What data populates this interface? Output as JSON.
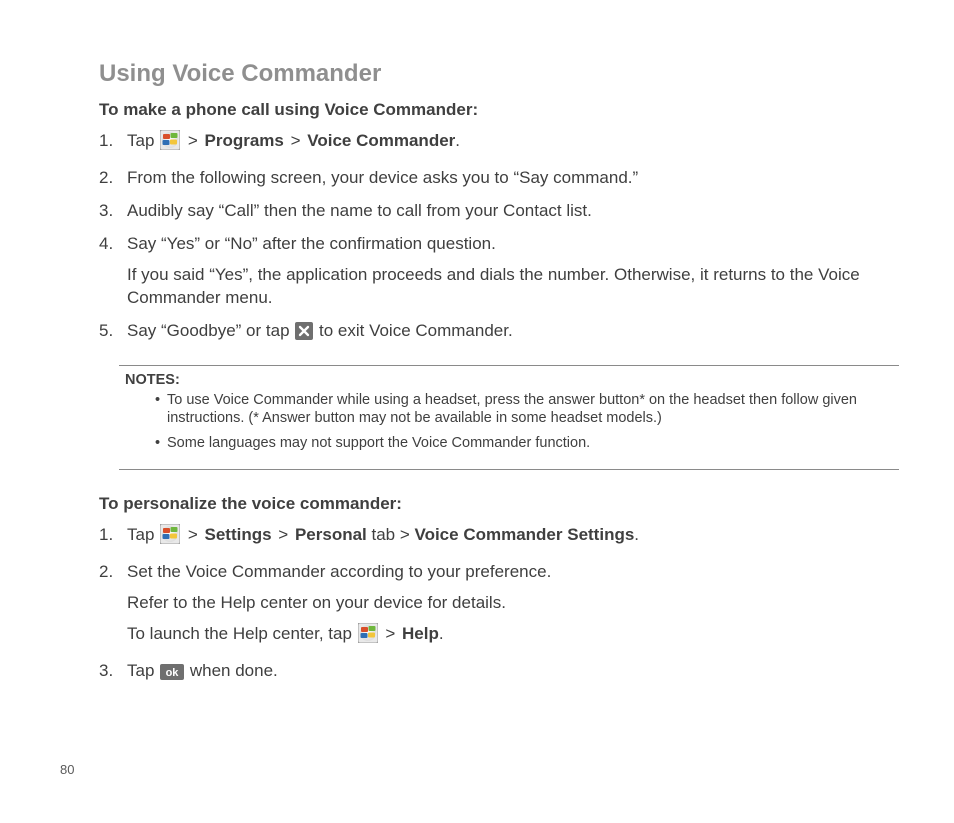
{
  "pageNumber": "80",
  "title": "Using Voice Commander",
  "section1": {
    "heading": "To make a phone call using Voice Commander:",
    "step1_pre": "Tap ",
    "step1_sep1": " > ",
    "step1_bold1": "Programs",
    "step1_sep2": " > ",
    "step1_bold2": "Voice Commander",
    "step1_end": ".",
    "step2": "From the following screen, your device asks you to “Say command.”",
    "step3": "Audibly say “Call” then the name to call from your Contact list.",
    "step4": " Say “Yes” or “No” after the confirmation question.",
    "step4_body": "If you said “Yes”, the application proceeds and dials the number. Otherwise, it returns to the Voice Commander menu.",
    "step5_pre": "Say “Goodbye” or tap ",
    "step5_post": " to exit Voice Commander."
  },
  "notes": {
    "label": "NOTES:",
    "n1": "To use Voice Commander while using a headset, press the answer button* on the headset then follow given instructions. (* Answer button may not be available in some headset models.)",
    "n2": "Some languages may not support the Voice Commander function."
  },
  "section2": {
    "heading": "To personalize the voice commander:",
    "step1_pre": "Tap ",
    "step1_sep1": " > ",
    "step1_bold1": "Settings",
    "step1_sep2": " > ",
    "step1_bold2": "Personal",
    "step1_mid": " tab > ",
    "step1_bold3": "Voice Commander Settings",
    "step1_end": ".",
    "step2": "Set the Voice Commander according to your preference.",
    "step2_body1": "Refer to the Help center on your device for details.",
    "step2_body2_pre": "To launch the Help center, tap ",
    "step2_body2_sep": " > ",
    "step2_body2_bold": "Help",
    "step2_body2_end": ".",
    "step3_pre": "Tap ",
    "step3_post": " when done."
  },
  "icons": {
    "start": "start-icon",
    "close": "close-icon",
    "ok": "ok-icon"
  }
}
